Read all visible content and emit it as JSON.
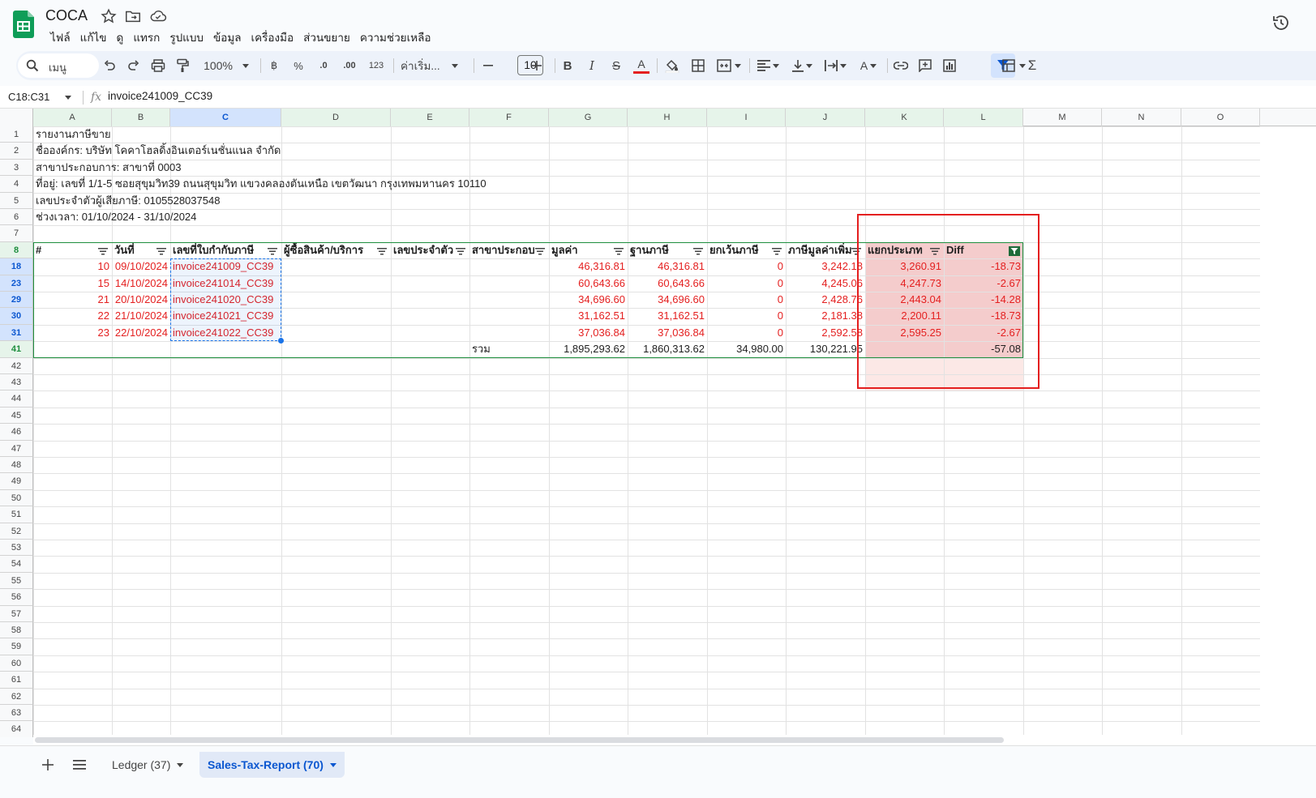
{
  "app": {
    "title": "COCA"
  },
  "menu": [
    "ไฟล์",
    "แก้ไข",
    "ดู",
    "แทรก",
    "รูปแบบ",
    "ข้อมูล",
    "เครื่องมือ",
    "ส่วนขยาย",
    "ความช่วยเหลือ"
  ],
  "toolbar": {
    "search_label": "เมนู",
    "zoom": "100%",
    "currency": "฿",
    "percent": "%",
    "dec_decrease": ".0",
    "dec_increase": ".00",
    "number_format": "123",
    "font": "ค่าเริ่ม...",
    "font_size": "10",
    "sigma": "Σ"
  },
  "formula_bar": {
    "name_box": "C18:C31",
    "fx": "fx",
    "value": "invoice241009_CC39"
  },
  "columns": [
    "A",
    "B",
    "C",
    "D",
    "E",
    "F",
    "G",
    "H",
    "I",
    "J",
    "K",
    "L",
    "M",
    "N",
    "O"
  ],
  "rows": [
    "1",
    "2",
    "3",
    "4",
    "5",
    "6",
    "7",
    "8",
    "18",
    "23",
    "29",
    "30",
    "31",
    "41",
    "42",
    "43",
    "44",
    "45",
    "46",
    "47",
    "48",
    "49",
    "50",
    "51",
    "52",
    "53",
    "54",
    "55",
    "56",
    "57",
    "58",
    "59",
    "60",
    "61",
    "62",
    "63",
    "64"
  ],
  "report": {
    "line1": "รายงานภาษีขาย",
    "line2": "ชื่อองค์กร: บริษัท โคคาโฮลดิ้งอินเตอร์เนชั่นแนล จำกัด",
    "line3": "สาขาประกอบการ: สาขาที่ 0003",
    "line4": "ที่อยู่: เลขที่ 1/1-5 ซอยสุขุมวิท39 ถนนสุขุมวิท แขวงคลองตันเหนือ เขตวัฒนา กรุงเทพมหานคร 10110",
    "line5": "เลขประจำตัวผู้เสียภาษี: 0105528037548",
    "line6": "ช่วงเวลา: 01/10/2024 - 31/10/2024"
  },
  "table": {
    "headers": [
      "#",
      "วันที่",
      "เลขที่ใบกำกับภาษี",
      "ผู้ซื้อสินค้า/บริการ",
      "เลขประจำตัว",
      "สาขาประกอบ",
      "มูลค่า",
      "ฐานภาษี",
      "ยกเว้นภาษี",
      "ภาษีมูลค่าเพิ่ม",
      "แยกประเภท",
      "Diff"
    ],
    "rows": [
      [
        "10",
        "09/10/2024",
        "invoice241009_CC39",
        "",
        "",
        "",
        "46,316.81",
        "46,316.81",
        "0",
        "3,242.18",
        "3,260.91",
        "-18.73"
      ],
      [
        "15",
        "14/10/2024",
        "invoice241014_CC39",
        "",
        "",
        "",
        "60,643.66",
        "60,643.66",
        "0",
        "4,245.06",
        "4,247.73",
        "-2.67"
      ],
      [
        "21",
        "20/10/2024",
        "invoice241020_CC39",
        "",
        "",
        "",
        "34,696.60",
        "34,696.60",
        "0",
        "2,428.76",
        "2,443.04",
        "-14.28"
      ],
      [
        "22",
        "21/10/2024",
        "invoice241021_CC39",
        "",
        "",
        "",
        "31,162.51",
        "31,162.51",
        "0",
        "2,181.38",
        "2,200.11",
        "-18.73"
      ],
      [
        "23",
        "22/10/2024",
        "invoice241022_CC39",
        "",
        "",
        "",
        "37,036.84",
        "37,036.84",
        "0",
        "2,592.58",
        "2,595.25",
        "-2.67"
      ]
    ],
    "total": {
      "label": "รวม",
      "value": "1,895,293.62",
      "tax_base": "1,860,313.62",
      "exempt": "34,980.00",
      "vat": "130,221.95",
      "diff": "-57.08"
    }
  },
  "sheets": [
    {
      "label": "Ledger (37)",
      "active": false
    },
    {
      "label": "Sales-Tax-Report (70)",
      "active": true
    }
  ],
  "colors": {
    "accent": "#0b57d0",
    "red": "#e41f1f",
    "highlight": "#f4cccc",
    "filter_green": "#1e8e3e"
  }
}
